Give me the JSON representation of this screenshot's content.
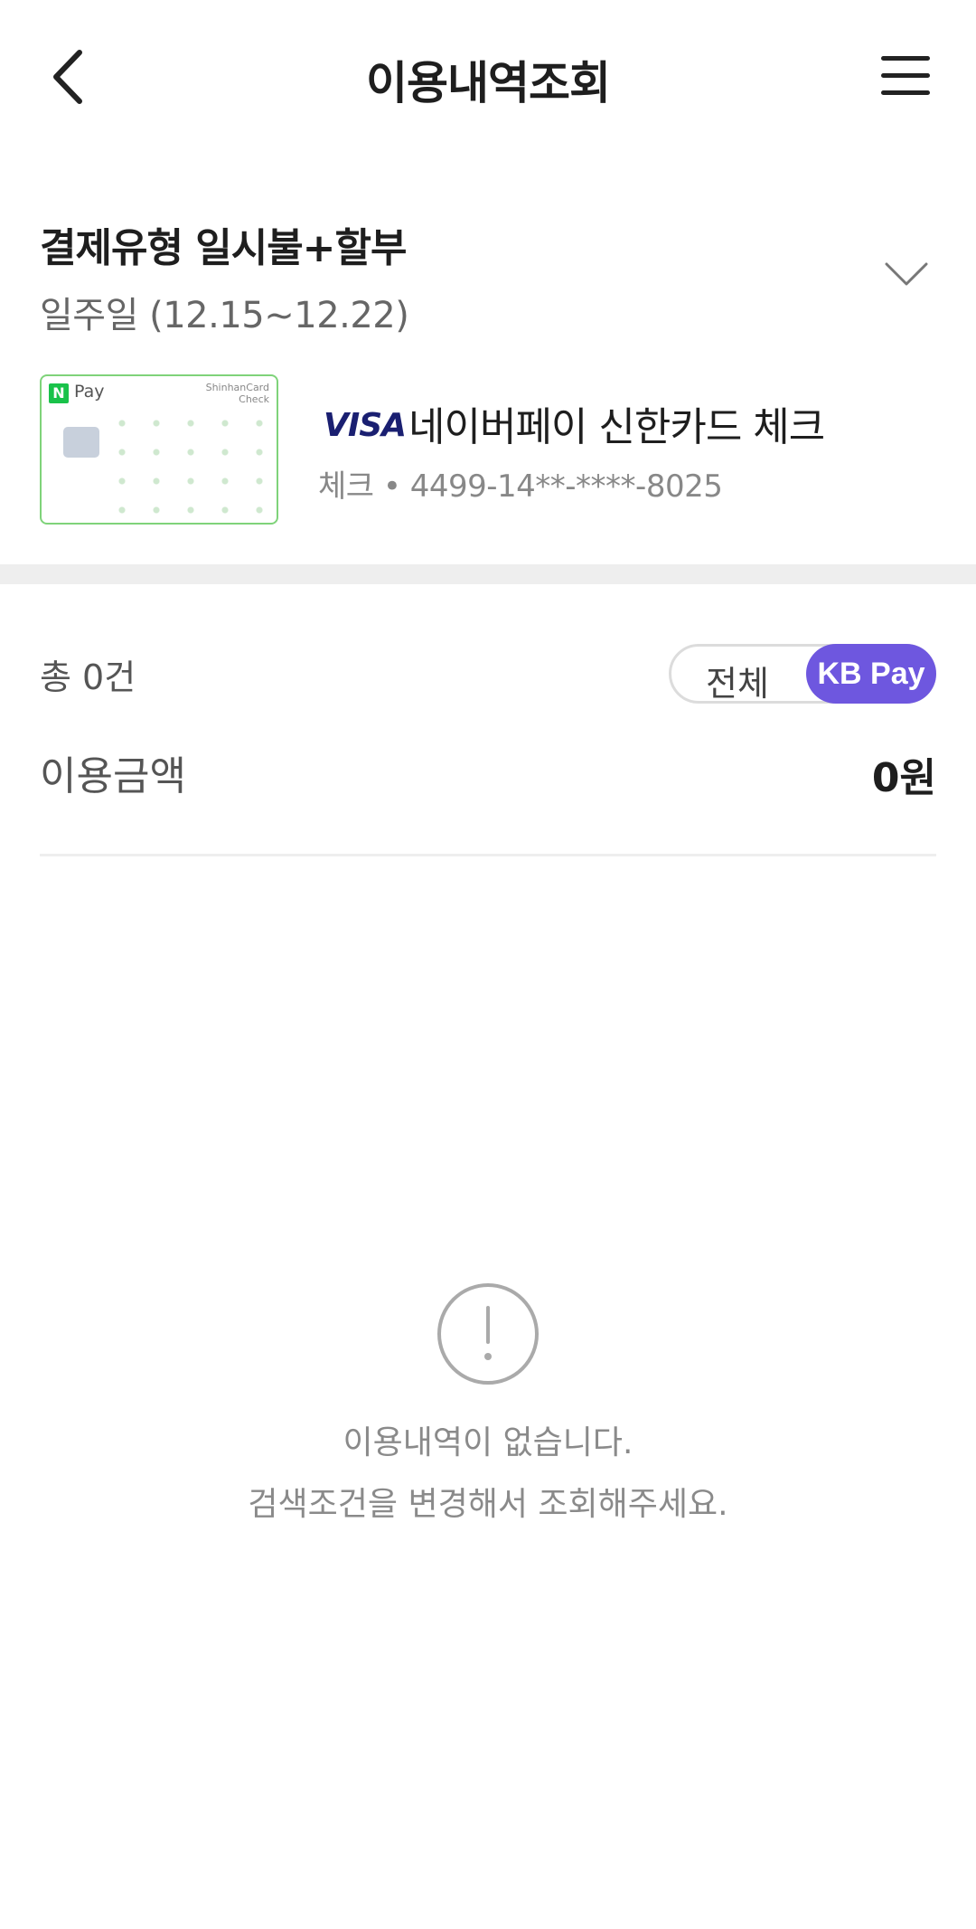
{
  "header": {
    "title": "이용내역조회",
    "back_icon": "chevron-left-icon",
    "menu_icon": "hamburger-menu-icon"
  },
  "filter": {
    "payment_type": "결제유형 일시불+할부",
    "period": "일주일 (12.15~12.22)",
    "expand_icon": "chevron-down-icon"
  },
  "card": {
    "image": {
      "pay_label": "Pay",
      "n_logo": "N",
      "brand_line1": "ShinhanCard",
      "brand_line2": "Check"
    },
    "network": "VISA",
    "name": "네이버페이 신한카드 체크",
    "number": "체크 • 4499-14**-****-8025"
  },
  "summary": {
    "total_count": "총 0건",
    "toggle_all": "전체",
    "toggle_kbpay": "KB Pay",
    "amount_label": "이용금액",
    "amount_value": "0원"
  },
  "empty_state": {
    "icon": "exclamation-circle-icon",
    "line1": "이용내역이 없습니다.",
    "line2": "검색조건을 변경해서 조회해주세요."
  },
  "colors": {
    "accent": "#6e57df",
    "card_border": "#7fd37a",
    "visa": "#1a1f71"
  }
}
